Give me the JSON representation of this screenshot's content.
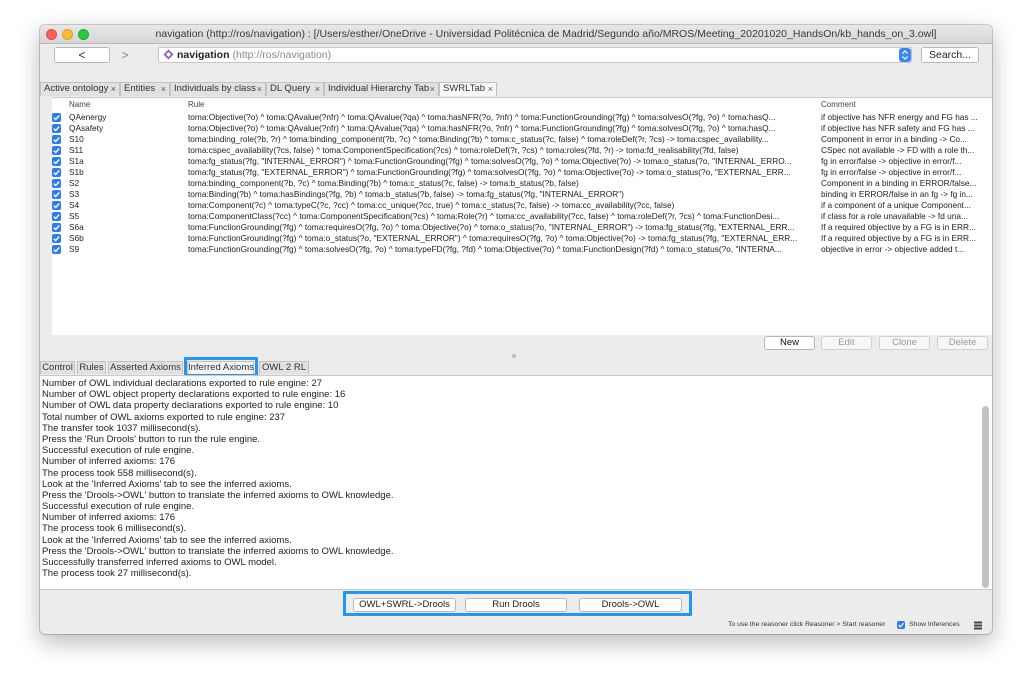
{
  "window": {
    "title": "navigation (http://ros/navigation)  : [/Users/esther/OneDrive - Universidad Politécnica de Madrid/Segundo año/MROS/Meeting_20201020_HandsOn/kb_hands_on_3.owl]"
  },
  "navbar": {
    "back_label": "<",
    "forward_label": ">",
    "url_main": "navigation",
    "url_sub": "(http://ros/navigation)",
    "search_label": "Search..."
  },
  "tabs": [
    {
      "label": "Active ontology",
      "close": "×"
    },
    {
      "label": "Entities",
      "close": "×"
    },
    {
      "label": "Individuals by class",
      "close": "×"
    },
    {
      "label": "DL Query",
      "close": "×"
    },
    {
      "label": "Individual Hierarchy Tab",
      "close": "×"
    },
    {
      "label": "SWRLTab",
      "close": "×",
      "active": true
    }
  ],
  "rules_table": {
    "headers": {
      "name": "Name",
      "rule": "Rule",
      "comment": "Comment"
    },
    "rows": [
      {
        "name": "QAenergy",
        "rule": "toma:Objective(?o) ^ toma:QAvalue(?nfr) ^ toma:QAvalue(?qa) ^ toma:hasNFR(?o, ?nfr) ^ toma:FunctionGrounding(?fg) ^ toma:solvesO(?fg, ?o) ^ toma:hasQ...",
        "comment": "if objective has NFR energy and FG has ..."
      },
      {
        "name": "QAsafety",
        "rule": "toma:Objective(?o) ^ toma:QAvalue(?nfr) ^ toma:QAvalue(?qa) ^ toma:hasNFR(?o, ?nfr) ^ toma:FunctionGrounding(?fg) ^ toma:solvesO(?fg, ?o) ^ toma:hasQ...",
        "comment": "if objective has NFR safety and FG has ..."
      },
      {
        "name": "S10",
        "rule": "toma:binding_role(?b, ?r) ^ toma:binding_component(?b, ?c) ^ toma:Binding(?b) ^ toma:c_status(?c, false) ^ toma:roleDef(?r, ?cs) -> toma:cspec_availability...",
        "comment": "Component in error in a binding -> Co..."
      },
      {
        "name": "S11",
        "rule": "toma:cspec_availability(?cs, false) ^ toma:ComponentSpecification(?cs) ^ toma:roleDef(?r, ?cs) ^ toma:roles(?fd, ?r) -> toma:fd_realisability(?fd, false)",
        "comment": "CSpec not available -> FD with a role th..."
      },
      {
        "name": "S1a",
        "rule": "toma:fg_status(?fg, \"INTERNAL_ERROR\") ^ toma:FunctionGrounding(?fg) ^ toma:solvesO(?fg, ?o) ^ toma:Objective(?o) -> toma:o_status(?o, \"INTERNAL_ERRO...",
        "comment": "fg in error/false -> objective in error/f..."
      },
      {
        "name": "S1b",
        "rule": "toma:fg_status(?fg, \"EXTERNAL_ERROR\") ^ toma:FunctionGrounding(?fg) ^ toma:solvesO(?fg, ?o) ^ toma:Objective(?o) -> toma:o_status(?o, \"EXTERNAL_ERR...",
        "comment": "fg in error/false -> objective in error/f..."
      },
      {
        "name": "S2",
        "rule": "toma:binding_component(?b, ?c) ^ toma:Binding(?b) ^ toma:c_status(?c, false) -> toma:b_status(?b, false)",
        "comment": "Component in a binding in ERROR/false..."
      },
      {
        "name": "S3",
        "rule": "toma:Binding(?b) ^ toma:hasBindings(?fg, ?b) ^ toma:b_status(?b, false) -> toma:fg_status(?fg, \"INTERNAL_ERROR\")",
        "comment": "binding in ERROR/false in an fg -> fg in..."
      },
      {
        "name": "S4",
        "rule": "toma:Component(?c) ^ toma:typeC(?c, ?cc) ^ toma:cc_unique(?cc, true) ^ toma:c_status(?c, false) -> toma:cc_availability(?cc, false)",
        "comment": "if a component of a unique Component..."
      },
      {
        "name": "S5",
        "rule": "toma:ComponentClass(?cc) ^ toma:ComponentSpecification(?cs) ^ toma:Role(?r) ^ toma:cc_availability(?cc, false) ^ toma:roleDef(?r, ?cs) ^ toma:FunctionDesi...",
        "comment": "if class for a role unavailable -> fd una..."
      },
      {
        "name": "S6a",
        "rule": "toma:FunctionGrounding(?fg) ^ toma:requiresO(?fg, ?o) ^ toma:Objective(?o) ^ toma:o_status(?o, \"INTERNAL_ERROR\") -> toma:fg_status(?fg, \"EXTERNAL_ERR...",
        "comment": "If a required objective by a FG is in ERR..."
      },
      {
        "name": "S6b",
        "rule": "toma:FunctionGrounding(?fg) ^ toma:o_status(?o, \"EXTERNAL_ERROR\") ^ toma:requiresO(?fg, ?o) ^ toma:Objective(?o) -> toma:fg_status(?fg, \"EXTERNAL_ERR...",
        "comment": "If a required objective by a FG is in ERR..."
      },
      {
        "name": "S9",
        "rule": "toma:FunctionGrounding(?fg) ^ toma:solvesO(?fg, ?o) ^ toma:typeFD(?fg, ?fd) ^ toma:Objective(?o) ^ toma:FunctionDesign(?fd) ^ toma:o_status(?o, \"INTERNA...",
        "comment": "objective in error -> objective added t..."
      }
    ]
  },
  "rule_buttons": {
    "new": "New",
    "edit": "Edit",
    "clone": "Clone",
    "delete": "Delete"
  },
  "lower_tabs": [
    {
      "label": "Control"
    },
    {
      "label": "Rules"
    },
    {
      "label": "Asserted Axioms"
    },
    {
      "label": "Inferred Axioms",
      "active": true
    },
    {
      "label": "OWL 2 RL"
    }
  ],
  "log": [
    "Number of OWL individual declarations exported to rule engine: 27",
    "Number of OWL object property declarations exported to rule engine: 16",
    "Number of OWL data property declarations exported to rule engine: 10",
    "Total number of OWL axioms exported to rule engine: 237",
    "The transfer took 1037 millisecond(s).",
    "Press the 'Run Drools' button to run the rule engine.",
    "Successful execution of rule engine.",
    "Number of inferred axioms: 176",
    "The process took 558 millisecond(s).",
    "Look at the 'Inferred Axioms' tab to see the inferred axioms.",
    "Press the 'Drools->OWL' button to translate the inferred axioms to OWL knowledge.",
    "Successful execution of rule engine.",
    "Number of inferred axioms: 176",
    "The process took 6 millisecond(s).",
    "Look at the 'Inferred Axioms' tab to see the inferred axioms.",
    "Press the 'Drools->OWL' button to translate the inferred axioms to OWL knowledge.",
    "Successfully transferred inferred axioms to OWL model.",
    "The process took 27 millisecond(s)."
  ],
  "control_buttons": {
    "owl_swrl_drools": "OWL+SWRL->Drools",
    "run_drools": "Run Drools",
    "drools_owl": "Drools->OWL"
  },
  "status": {
    "hint": "To use the reasoner click Reasoner > Start reasoner",
    "show_inferences": "Show Inferences"
  },
  "colors": {
    "highlight": "#2196f3",
    "checkbox": "#2b7cf3",
    "traffic_close": "#fc5f57",
    "traffic_min": "#fdbc2e",
    "traffic_max": "#28c840"
  }
}
